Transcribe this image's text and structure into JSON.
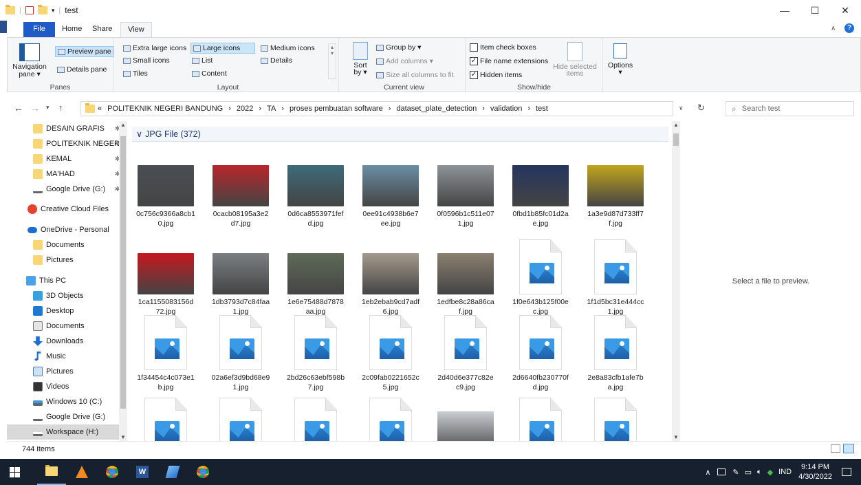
{
  "window": {
    "title": "test",
    "minimize": "—",
    "maximize": "☐",
    "close": "✕"
  },
  "tabs": [
    "File",
    "Home",
    "Share",
    "View"
  ],
  "ribbon": {
    "panes": {
      "navigation": "Navigation",
      "navigation2": "pane ▾",
      "preview": "Preview pane",
      "details": "Details pane",
      "label": "Panes"
    },
    "layout": {
      "xl": "Extra large icons",
      "large": "Large icons",
      "medium": "Medium icons",
      "small": "Small icons",
      "list": "List",
      "details": "Details",
      "tiles": "Tiles",
      "content": "Content",
      "label": "Layout"
    },
    "current": {
      "sort": "Sort",
      "sort2": "by ▾",
      "group": "Group by ▾",
      "addcols": "Add columns ▾",
      "sizecols": "Size all columns to fit",
      "label": "Current view"
    },
    "showhide": {
      "checkboxes": "Item check boxes",
      "extensions": "File name extensions",
      "hidden": "Hidden items",
      "hide_selected": "Hide selected",
      "hide_selected2": "items",
      "label": "Show/hide"
    },
    "options": "Options",
    "options2": "▾"
  },
  "address": {
    "prefix": "«",
    "path": [
      "POLITEKNIK NEGERI BANDUNG",
      "2022",
      "TA",
      "proses pembuatan software",
      "dataset_plate_detection",
      "validation",
      "test"
    ],
    "search_placeholder": "Search test"
  },
  "nav": [
    {
      "label": "DESAIN GRAFIS",
      "icon": "folder-icon",
      "pin": true
    },
    {
      "label": "POLITEKNIK NEGER",
      "icon": "folder-icon",
      "pin": true
    },
    {
      "label": "KEMAL",
      "icon": "folder-icon",
      "pin": true
    },
    {
      "label": "MA'HAD",
      "icon": "folder-icon",
      "pin": true
    },
    {
      "label": "Google Drive (G:)",
      "icon": "drive-icon",
      "pin": true
    },
    {
      "label": "Creative Cloud Files",
      "icon": "creative-cloud-icon",
      "pin": false
    },
    {
      "label": "OneDrive - Personal",
      "icon": "onedrive-icon",
      "pin": false
    },
    {
      "label": "Documents",
      "icon": "folder-icon",
      "pin": false
    },
    {
      "label": "Pictures",
      "icon": "folder-icon",
      "pin": false
    },
    {
      "label": "This PC",
      "icon": "pc-icon",
      "pin": false
    },
    {
      "label": "3D Objects",
      "icon": "3d-objects-icon",
      "pin": false
    },
    {
      "label": "Desktop",
      "icon": "desktop-icon",
      "pin": false
    },
    {
      "label": "Documents",
      "icon": "documents-icon",
      "pin": false
    },
    {
      "label": "Downloads",
      "icon": "downloads-icon",
      "pin": false
    },
    {
      "label": "Music",
      "icon": "music-icon",
      "pin": false
    },
    {
      "label": "Pictures",
      "icon": "pictures-icon",
      "pin": false
    },
    {
      "label": "Videos",
      "icon": "videos-icon",
      "pin": false
    },
    {
      "label": "Windows 10 (C:)",
      "icon": "windows-drive-icon",
      "pin": false
    },
    {
      "label": "Google Drive (G:)",
      "icon": "drive-icon",
      "pin": false
    },
    {
      "label": "Workspace (H:)",
      "icon": "drive-icon",
      "pin": false
    }
  ],
  "group": {
    "label": "JPG File (372)",
    "chevron": "∨"
  },
  "files": [
    {
      "name": "0c756c9366a8cb10.jpg",
      "type": "photo",
      "color": "#4a4f55"
    },
    {
      "name": "0cacb08195a3e2d7.jpg",
      "type": "photo",
      "color": "#b8262b"
    },
    {
      "name": "0d6ca8553971fefd.jpg",
      "type": "photo",
      "color": "#3d6b7a"
    },
    {
      "name": "0ee91c4938b6e7ee.jpg",
      "type": "photo",
      "color": "#6b8fa6"
    },
    {
      "name": "0f0596b1c511e071.jpg",
      "type": "photo",
      "color": "#8e9499"
    },
    {
      "name": "0fbd1b85fc01d2ae.jpg",
      "type": "photo",
      "color": "#25355e"
    },
    {
      "name": "1a3e9d87d733ff7f.jpg",
      "type": "photo",
      "color": "#c2a51d"
    },
    {
      "name": "1ca1155083156d72.jpg",
      "type": "photo",
      "color": "#c4181e"
    },
    {
      "name": "1db3793d7c84faa1.jpg",
      "type": "photo",
      "color": "#7b7f82"
    },
    {
      "name": "1e6e75488d7878aa.jpg",
      "type": "photo",
      "color": "#5f6b58"
    },
    {
      "name": "1eb2ebab9cd7adf6.jpg",
      "type": "photo",
      "color": "#a49a8c"
    },
    {
      "name": "1edfbe8c28a86caf.jpg",
      "type": "photo",
      "color": "#8b8070"
    },
    {
      "name": "1f0e643b125f00ec.jpg",
      "type": "icon",
      "color": "#3b9ae5"
    },
    {
      "name": "1f1d5bc31e444cc1.jpg",
      "type": "icon",
      "color": "#3b9ae5"
    },
    {
      "name": "1f34454c4c073e1b.jpg",
      "type": "icon",
      "color": "#3b9ae5"
    },
    {
      "name": "02a6ef3d9bd68e91.jpg",
      "type": "icon",
      "color": "#3b9ae5"
    },
    {
      "name": "2bd26c63ebf598b7.jpg",
      "type": "icon",
      "color": "#3b9ae5"
    },
    {
      "name": "2c09fab0221652c5.jpg",
      "type": "icon",
      "color": "#3b9ae5"
    },
    {
      "name": "2d40d6e377c82ec9.jpg",
      "type": "icon",
      "color": "#3b9ae5"
    },
    {
      "name": "2d6640fb230770fd.jpg",
      "type": "icon",
      "color": "#3b9ae5"
    },
    {
      "name": "2e8a83cfb1afe7ba.jpg",
      "type": "icon",
      "color": "#3b9ae5"
    },
    {
      "name": "",
      "type": "icon",
      "color": "#3b9ae5"
    },
    {
      "name": "",
      "type": "icon",
      "color": "#3b9ae5"
    },
    {
      "name": "",
      "type": "icon",
      "color": "#3b9ae5"
    },
    {
      "name": "",
      "type": "icon",
      "color": "#3b9ae5"
    },
    {
      "name": "",
      "type": "photo",
      "color": "#c9ced3"
    },
    {
      "name": "",
      "type": "icon",
      "color": "#3b9ae5"
    },
    {
      "name": "",
      "type": "icon",
      "color": "#3b9ae5"
    }
  ],
  "preview_text": "Select a file to preview.",
  "status": {
    "count": "744 items"
  },
  "taskbar": {
    "time": "9:14 PM",
    "date": "4/30/2022",
    "lang": "IND"
  },
  "colors": {
    "accent": "#1e5bc7",
    "selection": "#cce4f7",
    "taskbar": "#16202e"
  }
}
